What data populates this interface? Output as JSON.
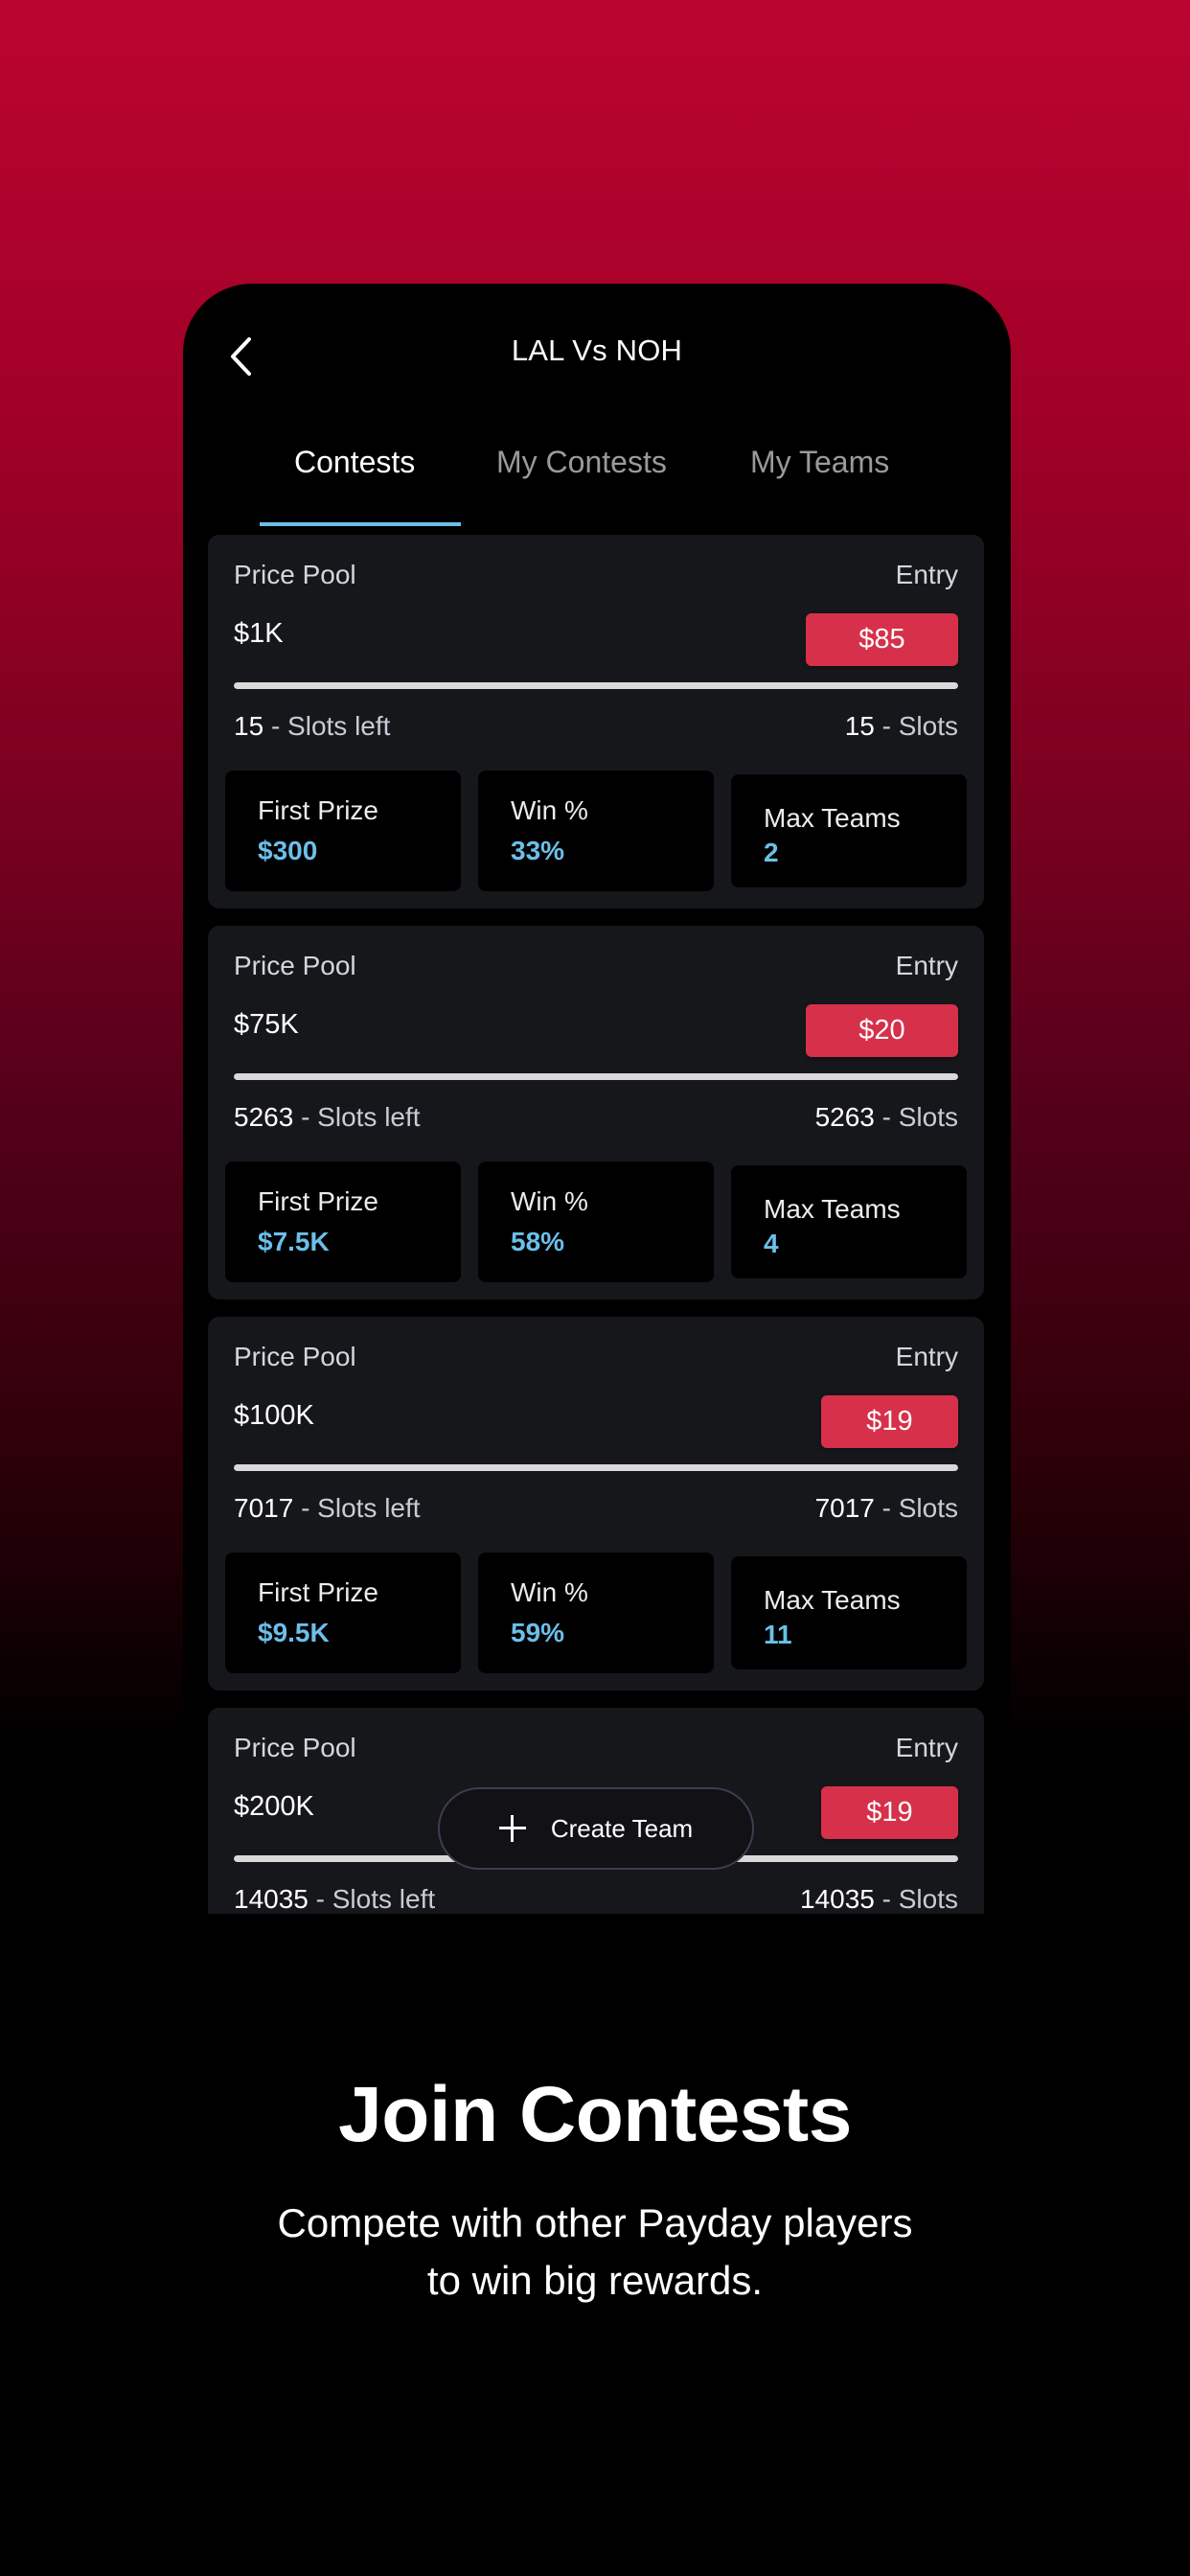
{
  "header": {
    "title": "LAL Vs NOH",
    "back_icon": "chevron-left-icon"
  },
  "tabs": [
    {
      "label": "Contests",
      "active": true
    },
    {
      "label": "My Contests",
      "active": false
    },
    {
      "label": "My Teams",
      "active": false
    }
  ],
  "labels": {
    "price_pool": "Price Pool",
    "entry": "Entry",
    "slots_left_suffix": "- Slots left",
    "slots_suffix": "- Slots",
    "first_prize": "First Prize",
    "win_pct": "Win %",
    "max_teams": "Max Teams"
  },
  "contests": [
    {
      "price_pool": "$1K",
      "entry_fee": "$85",
      "progress_fraction": 1.0,
      "slots_left": "15",
      "slots_total": "15",
      "first_prize": "$300",
      "win_pct": "33%",
      "max_teams": "2"
    },
    {
      "price_pool": "$75K",
      "entry_fee": "$20",
      "progress_fraction": 1.0,
      "slots_left": "5263",
      "slots_total": "5263",
      "first_prize": "$7.5K",
      "win_pct": "58%",
      "max_teams": "4"
    },
    {
      "price_pool": "$100K",
      "entry_fee": "$19",
      "progress_fraction": 1.0,
      "slots_left": "7017",
      "slots_total": "7017",
      "first_prize": "$9.5K",
      "win_pct": "59%",
      "max_teams": "11"
    },
    {
      "price_pool": "$200K",
      "entry_fee": "$19",
      "progress_fraction": 1.0,
      "slots_left": "14035",
      "slots_total": "14035",
      "first_prize": "",
      "win_pct": "",
      "max_teams": ""
    }
  ],
  "create_team": {
    "label": "Create Team",
    "icon": "plus-icon"
  },
  "promo": {
    "title": "Join Contests",
    "subtitle_line1": "Compete with other Payday players",
    "subtitle_line2": "to win big rewards."
  },
  "colors": {
    "accent_blue": "#6cbfe9",
    "entry_red": "#d6304a",
    "background_top": "#bb0530",
    "card_bg": "#16171b"
  }
}
